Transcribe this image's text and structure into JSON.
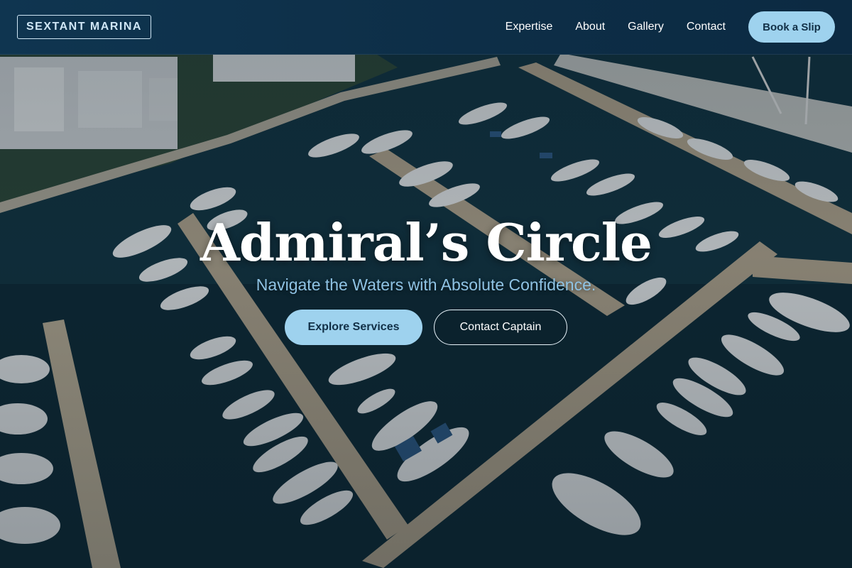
{
  "navbar": {
    "brand": "SEXTANT MARINA",
    "links": [
      {
        "label": "Expertise"
      },
      {
        "label": "About"
      },
      {
        "label": "Gallery"
      },
      {
        "label": "Contact"
      }
    ],
    "cta_label": "Book a Slip"
  },
  "hero": {
    "title": "Admiral’s Circle",
    "subtitle": "Navigate the Waters with Absolute Confidence.",
    "primary_button": "Explore Services",
    "secondary_button": "Contact Captain"
  },
  "colors": {
    "nav_bg": "#0f3550",
    "accent": "#9ed2ee",
    "subtitle": "#8fc3e4",
    "water": "#123240",
    "dock": "#b9ab93"
  }
}
